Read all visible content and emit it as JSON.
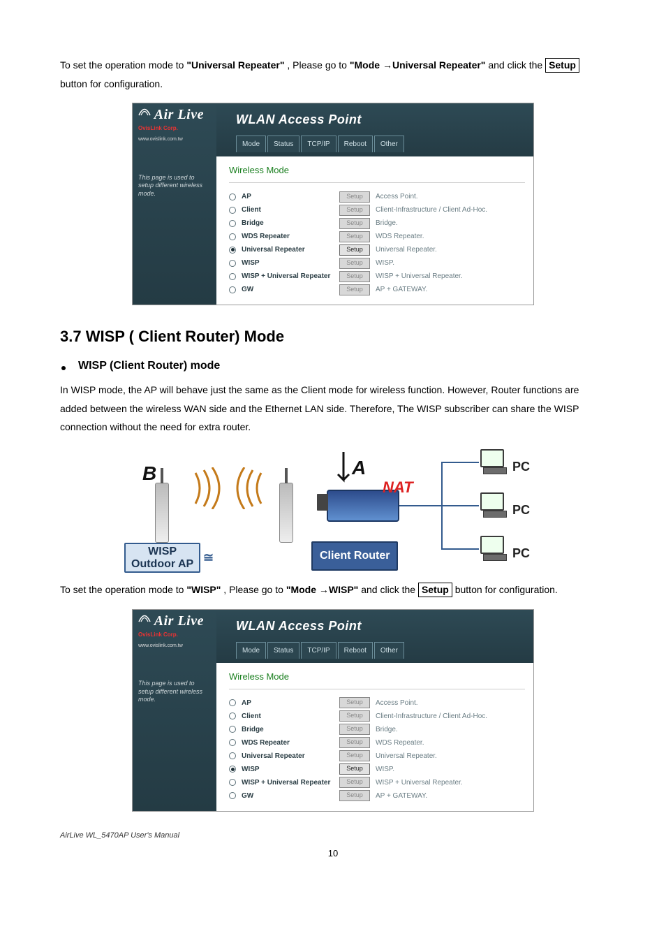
{
  "para1_a": "To set the operation mode to ",
  "para1_b": "\"Universal Repeater\"",
  "para1_c": ", Please go to ",
  "para1_d": "\"Mode ",
  "para1_arrow": "→",
  "para1_e": "Universal Repeater\"",
  "para1_f": " and click the ",
  "para1_setup": "Setup",
  "para1_g": " button for configuration.",
  "ui": {
    "logo": "Air Live",
    "corp": "OvisLink Corp.",
    "url": "www.ovislink.com.tw",
    "title": "WLAN Access Point",
    "tabs": [
      "Mode",
      "Status",
      "TCP/IP",
      "Reboot",
      "Other"
    ],
    "section": "Wireless Mode",
    "sidenote": "This page is used to setup different wireless mode.",
    "setup_label": "Setup",
    "modes": [
      {
        "name": "AP",
        "desc": "Access Point."
      },
      {
        "name": "Client",
        "desc": "Client-Infrastructure / Client Ad-Hoc."
      },
      {
        "name": "Bridge",
        "desc": "Bridge."
      },
      {
        "name": "WDS Repeater",
        "desc": "WDS Repeater."
      },
      {
        "name": "Universal Repeater",
        "desc": "Universal Repeater."
      },
      {
        "name": "WISP",
        "desc": "WISP."
      },
      {
        "name": "WISP + Universal Repeater",
        "desc": "WISP + Universal Repeater."
      },
      {
        "name": "GW",
        "desc": "AP + GATEWAY."
      }
    ]
  },
  "screenshot1_selected_index": 4,
  "screenshot2_selected_index": 5,
  "heading_37": "3.7 WISP ( Client Router) Mode",
  "bullet_37": "WISP (Client Router) mode",
  "para2": "In WISP mode, the AP will behave just the same as the Client mode for wireless function. However, Router functions are added between the wireless WAN side and the Ethernet LAN side. Therefore, The WISP subscriber can share the WISP connection without the need for extra router.",
  "diagram": {
    "b": "B",
    "a": "A",
    "nat": "NAT",
    "pc": "PC",
    "outdoor_box_l1": "WISP",
    "outdoor_box_l2": "Outdoor AP",
    "client_box": "Client Router"
  },
  "para3_a": "To set the operation mode to ",
  "para3_b": "\"WISP\"",
  "para3_c": ", Please go to ",
  "para3_d": "\"Mode ",
  "para3_arrow": "→",
  "para3_e": "WISP\"",
  "para3_f": " and click the ",
  "para3_setup": "Setup",
  "para3_g": " button for configuration.",
  "footer": "AirLive WL_5470AP User's Manual",
  "page_number": "10"
}
